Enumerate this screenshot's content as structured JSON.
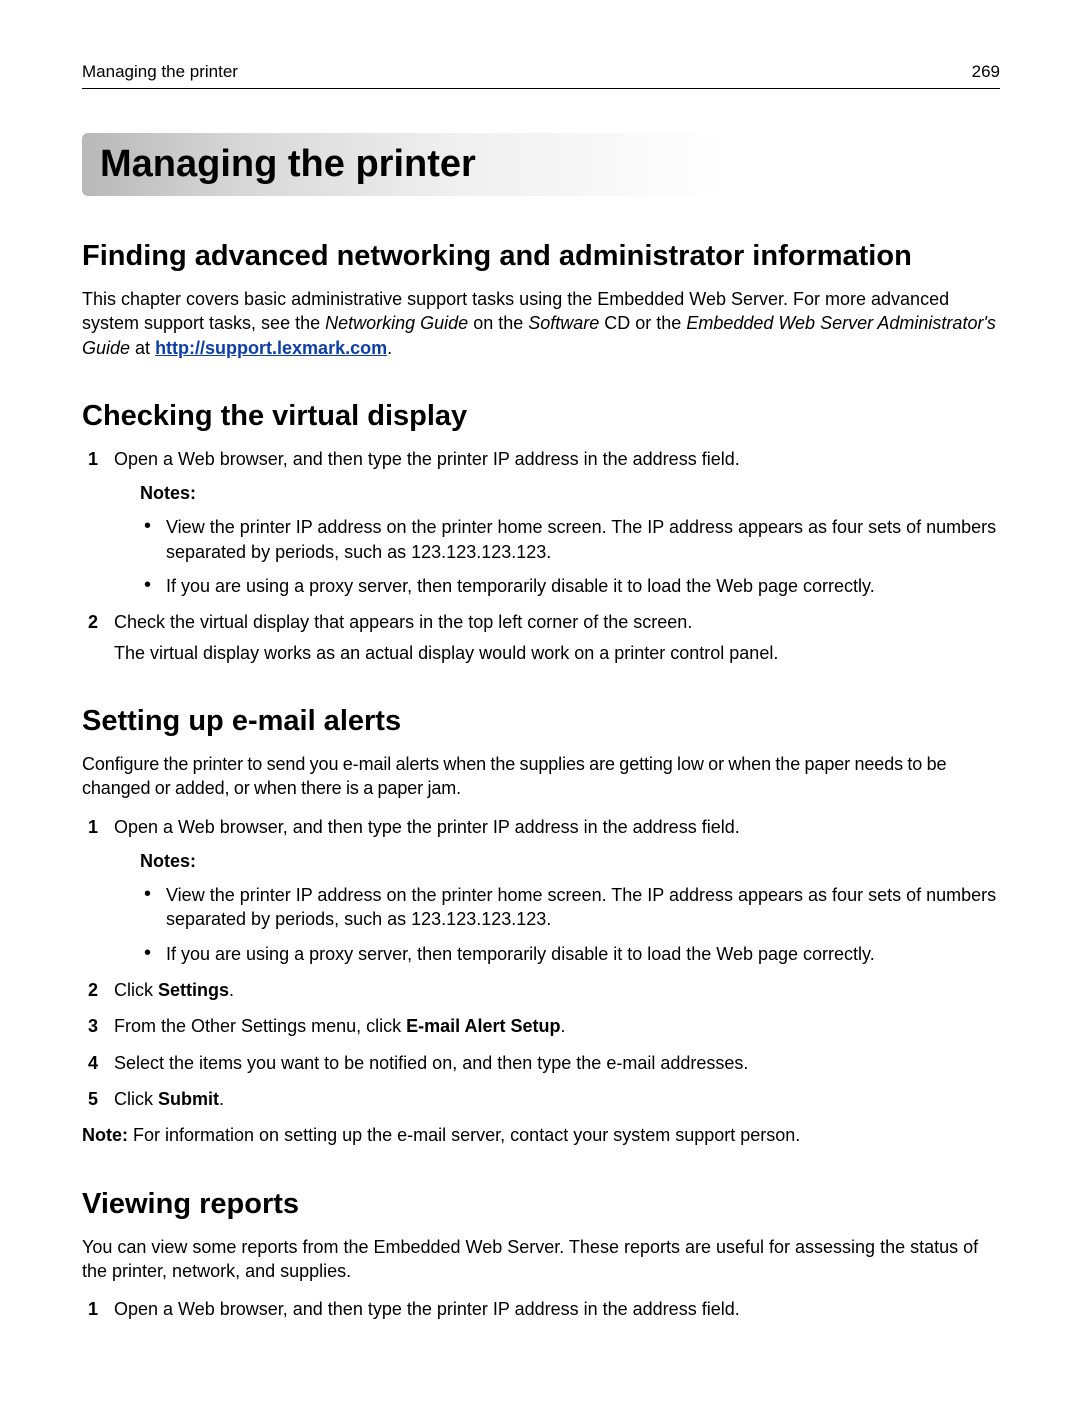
{
  "header": {
    "title": "Managing the printer",
    "page": "269"
  },
  "chapter": {
    "title": "Managing the printer"
  },
  "s1": {
    "title": "Finding advanced networking and administrator information",
    "p_a": "This chapter covers basic administrative support tasks using the Embedded Web Server. For more advanced system support tasks, see the ",
    "p_i1": "Networking Guide",
    "p_b": " on the ",
    "p_i2": "Software",
    "p_c": " CD or the ",
    "p_i3": "Embedded Web Server Administrator's Guide",
    "p_d": " at ",
    "link": "http://support.lexmark.com",
    "p_e": "."
  },
  "s2": {
    "title": "Checking the virtual display",
    "step1": "Open a Web browser, and then type the printer IP address in the address field.",
    "notes_label": "Notes:",
    "note_a": "View the printer IP address on the printer home screen. The IP address appears as four sets of numbers separated by periods, such as 123.123.123.123.",
    "note_b": "If you are using a proxy server, then temporarily disable it to load the Web page correctly.",
    "step2": "Check the virtual display that appears in the top left corner of the screen.",
    "step2_cont": "The virtual display works as an actual display would work on a printer control panel."
  },
  "s3": {
    "title": "Setting up e‑mail alerts",
    "intro": "Configure the printer to send you e‑mail alerts when the supplies are getting low or when the paper needs to be changed or added, or when there is a paper jam.",
    "step1": "Open a Web browser, and then type the printer IP address in the address field.",
    "notes_label": "Notes:",
    "note_a": "View the printer IP address on the printer home screen. The IP address appears as four sets of numbers separated by periods, such as 123.123.123.123.",
    "note_b": "If you are using a proxy server, then temporarily disable it to load the Web page correctly.",
    "step2_a": "Click ",
    "step2_b": "Settings",
    "step2_c": ".",
    "step3_a": "From the Other Settings menu, click ",
    "step3_b": "E‑mail Alert Setup",
    "step3_c": ".",
    "step4": "Select the items you want to be notified on, and then type the e‑mail addresses.",
    "step5_a": "Click ",
    "step5_b": "Submit",
    "step5_c": ".",
    "footnote_a": "Note:",
    "footnote_b": " For information on setting up the e‑mail server, contact your system support person."
  },
  "s4": {
    "title": "Viewing reports",
    "intro": "You can view some reports from the Embedded Web Server. These reports are useful for assessing the status of the printer, network, and supplies.",
    "step1": "Open a Web browser, and then type the printer IP address in the address field."
  }
}
